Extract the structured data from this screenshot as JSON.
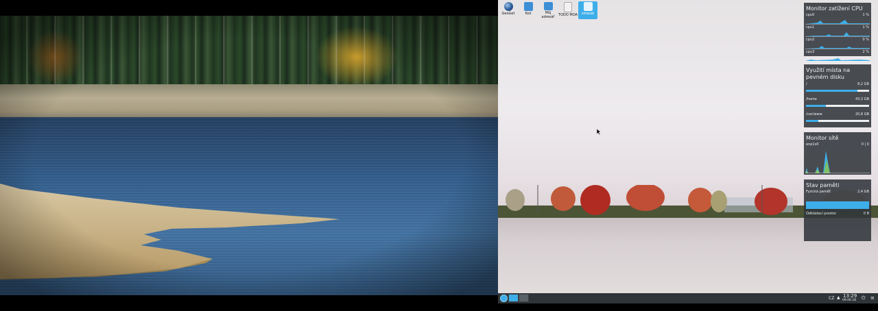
{
  "desktop_icons": [
    {
      "label": "GeoGet",
      "icon": "globe-icon"
    },
    {
      "label": "Koš",
      "icon": "trash-folder-icon"
    },
    {
      "label": "Můj adresář",
      "icon": "home-folder-icon"
    },
    {
      "label": "TODO MOA",
      "icon": "text-document-icon"
    },
    {
      "label": "smazat",
      "icon": "folder-icon",
      "selected": true
    }
  ],
  "cpu_widget": {
    "title": "Monitor zatížení CPU",
    "cores": [
      {
        "name": "cpu0",
        "value": "1 %"
      },
      {
        "name": "cpu1",
        "value": "1 %"
      },
      {
        "name": "cpu2",
        "value": "0 %"
      },
      {
        "name": "cpu3",
        "value": "2 %"
      }
    ]
  },
  "disk_widget": {
    "title": "Využití místa na pevném disku",
    "mounts": [
      {
        "name": "/",
        "value": "8,2 GB",
        "usage": 0.82
      },
      {
        "name": "/home",
        "value": "43,3 GB",
        "usage": 0.32
      },
      {
        "name": "/var/www",
        "value": "20,8 GB",
        "usage": 0.2
      }
    ]
  },
  "network_widget": {
    "title": "Monitor sítě",
    "interface": "enp1s0",
    "value": "0 | 0"
  },
  "memory_widget": {
    "title": "Stav paměti",
    "physical_label": "Fyzická paměť",
    "physical_value": "2,4 GB",
    "physical_usage": 1.0,
    "swap_label": "Odkládací prostor",
    "swap_value": "0 B"
  },
  "panel": {
    "keyboard_layout": "CZ",
    "clock_time": "13:29",
    "clock_date": "09.06.18",
    "colors": {
      "accent": "#3daee9",
      "panel_bg": "#2f3438"
    }
  }
}
